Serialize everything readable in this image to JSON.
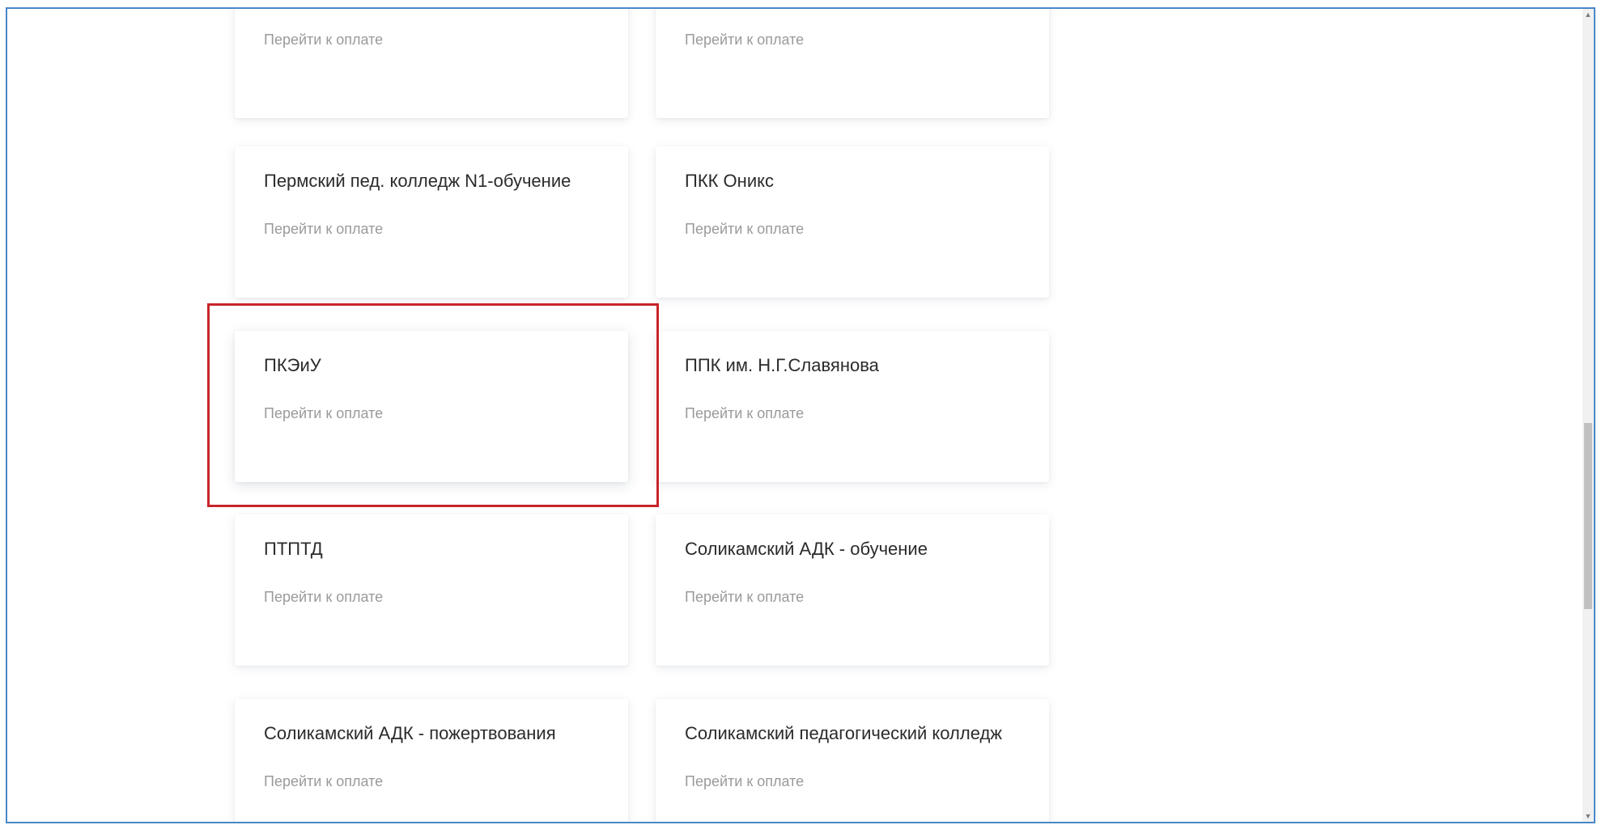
{
  "cards": [
    {
      "title": "",
      "link": "Перейти к оплате"
    },
    {
      "title": "",
      "link": "Перейти к оплате"
    },
    {
      "title": "Пермский пед. колледж N1-обучение",
      "link": "Перейти к оплате"
    },
    {
      "title": "ПКК Оникс",
      "link": "Перейти к оплате"
    },
    {
      "title": "ПКЭиУ",
      "link": "Перейти к оплате"
    },
    {
      "title": "ППК им. Н.Г.Славянова",
      "link": "Перейти к оплате"
    },
    {
      "title": "ПТПТД",
      "link": "Перейти к оплате"
    },
    {
      "title": "Соликамский АДК - обучение",
      "link": "Перейти к оплате"
    },
    {
      "title": "Соликамский АДК - пожертвования",
      "link": "Перейти к оплате"
    },
    {
      "title": "Соликамский педагогический колледж",
      "link": "Перейти к оплате"
    }
  ],
  "scrollbar": {
    "up_icon": "chevron-up-icon",
    "down_icon": "chevron-down-icon"
  },
  "colors": {
    "frame_border": "#4a86c8",
    "highlight": "#c8242b",
    "title_text": "#2b2b2b",
    "link_text": "#9a9a9a"
  }
}
